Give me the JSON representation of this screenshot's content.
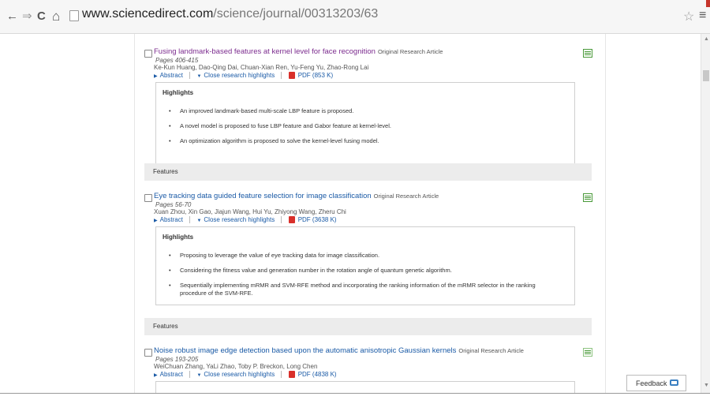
{
  "browser": {
    "url_host": "www.sciencedirect.com",
    "url_path": "/science/journal/00313203/63",
    "nav_icons": [
      "back-arrow-icon",
      "forward-arrow-icon",
      "reload-icon",
      "home-icon"
    ],
    "back": "←",
    "forward": "⇒",
    "reload": "C",
    "home": "⌂",
    "star": "☆",
    "menu": "≡"
  },
  "articles": [
    {
      "title": "Fusing landmark-based features at kernel level for face recognition",
      "type": "Original Research Article",
      "pages": "Pages 406-415",
      "authors": "Ke-Kun Huang, Dao-Qing Dai, Chuan-Xian Ren, Yu-Feng Yu, Zhao-Rong Lai",
      "abstract": "Abstract",
      "close_highlights": "Close research highlights",
      "pdf": "PDF (853 K)",
      "highlights_title": "Highlights",
      "highlights": [
        "An improved landmark-based multi-scale LBP feature is proposed.",
        "A novel model is proposed to fuse LBP feature and Gabor feature at kernel-level.",
        "An optimization algorithm is proposed to solve the kernel-level fusing model."
      ]
    },
    {
      "title": "Eye tracking data guided feature selection for image classification",
      "type": "Original Research Article",
      "pages": "Pages 56-70",
      "authors": "Xuan Zhou, Xin Gao, Jiajun Wang, Hui Yu, Zhiyong Wang, Zheru Chi",
      "abstract": "Abstract",
      "close_highlights": "Close research highlights",
      "pdf": "PDF (3638 K)",
      "highlights_title": "Highlights",
      "highlights": [
        "Proposing to leverage the value of eye tracking data for image classification.",
        "Considering the fitness value and generation number in the rotation angle of quantum genetic algorithm.",
        "Sequentially implementing mRMR and SVM-RFE method and incorporating the ranking information of the mRMR selector in the ranking procedure of the SVM-RFE."
      ]
    },
    {
      "title": "Noise robust image edge detection based upon the automatic anisotropic Gaussian kernels",
      "type": "Original Research Article",
      "pages": "Pages 193-205",
      "authors": "WeiChuan Zhang, YaLi Zhao, Toby P. Breckon, Long Chen",
      "abstract": "Abstract",
      "close_highlights": "Close research highlights",
      "pdf": "PDF (4838 K)"
    }
  ],
  "sections": [
    "Features",
    "Features"
  ],
  "feedback": "Feedback",
  "colors": {
    "link": "#1a5aa6",
    "visited": "#7b2b8e",
    "pdf_red": "#d9302b"
  }
}
